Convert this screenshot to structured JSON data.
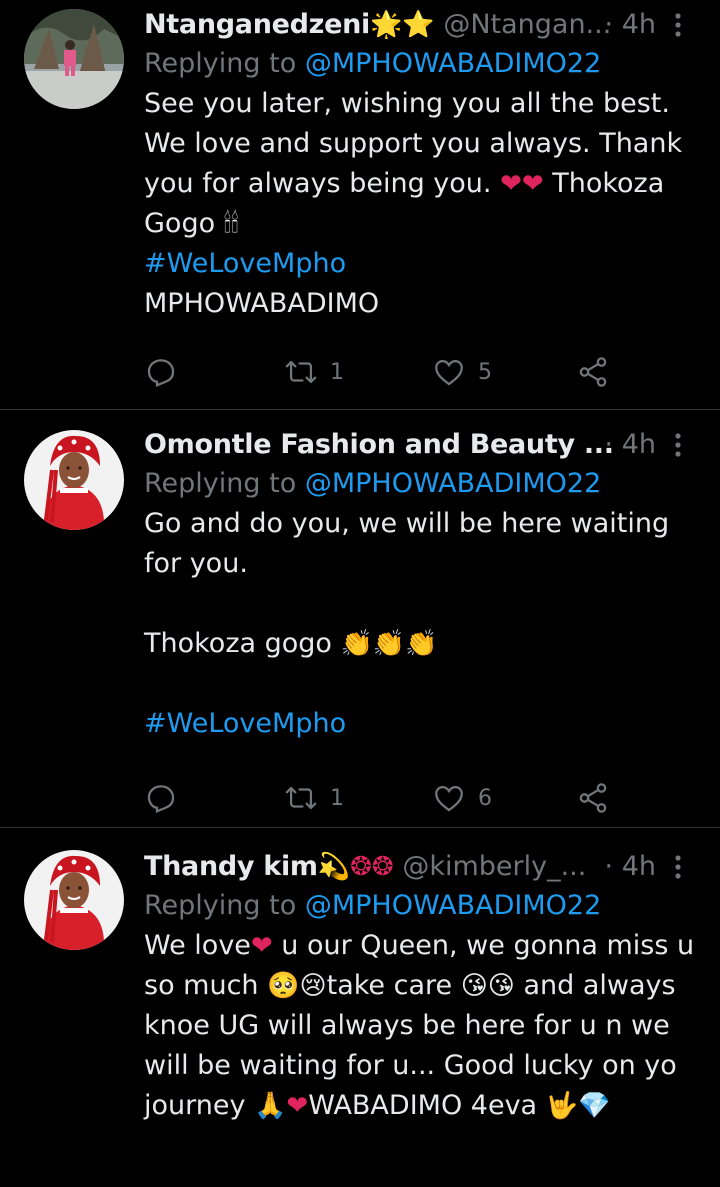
{
  "colors": {
    "background": "#000000",
    "text": "#e7e9ea",
    "muted": "#71767b",
    "link": "#1d9bf0",
    "divider": "#2f3336",
    "heart_emoji": "#e0245e"
  },
  "tweets": [
    {
      "name": "Ntanganedzeni",
      "name_emoji": "🌟⭐",
      "handle": "@Ntangan...",
      "time": "· 4h",
      "reply_prefix": "Replying to ",
      "reply_to": "@MPHOWABADIMO22",
      "text_1": "See you later, wishing you all the best. We love and support you always. Thank you for always being you. ",
      "text_emoji_1": "❤❤",
      "text_2": " Thokoza Gogo ",
      "text_emoji_2": "🕯🕯",
      "hashtag": "#WeLoveMpho",
      "text_3": "MPHOWABADIMO",
      "replies_icon": "reply-icon",
      "retweets": "1",
      "likes": "5"
    },
    {
      "name": "Omontle Fashion and Beauty ...",
      "handle": "",
      "time": "· 4h",
      "reply_prefix": "Replying to ",
      "reply_to": "@MPHOWABADIMO22",
      "text_1": "Go and do you, we will be here waiting for you.",
      "text_2": "Thokoza gogo ",
      "text_emoji_2": "👏👏👏",
      "hashtag": "#WeLoveMpho",
      "retweets": "1",
      "likes": "6"
    },
    {
      "name": "Thandy kim",
      "name_emoji": "💫❂❂",
      "handle": "@kimberly_...",
      "time": "· 4h",
      "reply_prefix": "Replying to ",
      "reply_to": "@MPHOWABADIMO22",
      "text_1": "We love",
      "text_emoji_1": "❤",
      "text_2": " u  our Queen, we gonna miss u so much ",
      "text_emoji_2": "🥺😢",
      "text_3": "take care ",
      "text_emoji_3": "😘😘",
      "text_4": " and always knoe UG will always be here for u n we will be waiting for u... Good lucky on yo journey ",
      "text_emoji_4": "🙏❤",
      "text_5": "WABADIMO 4eva ",
      "text_emoji_5": "🤟",
      "text_emoji_6": "💎"
    }
  ]
}
